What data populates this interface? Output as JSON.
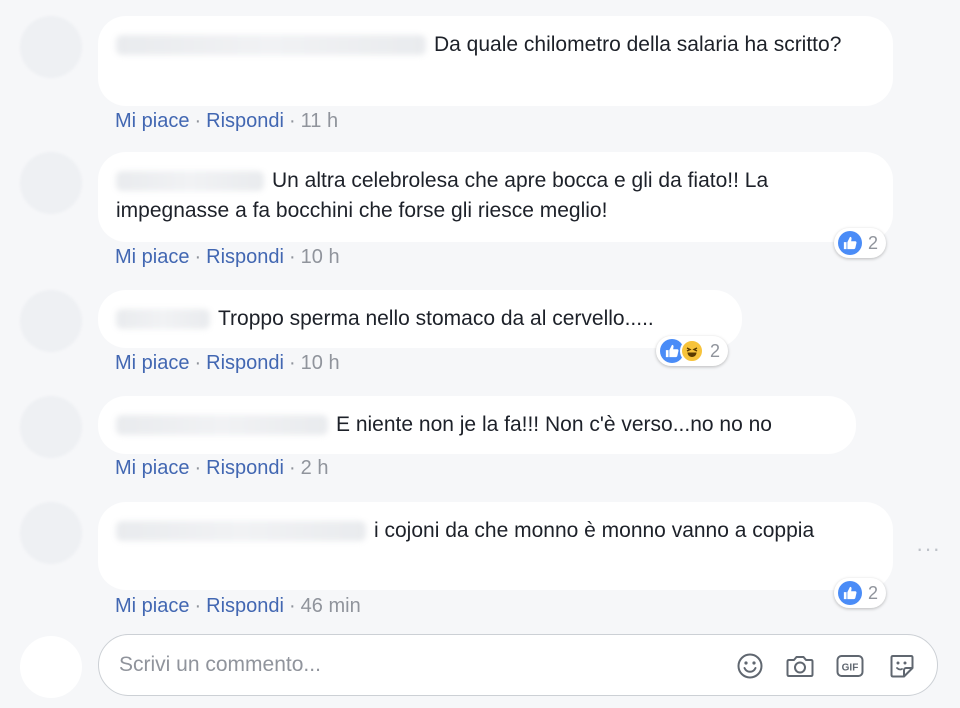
{
  "comments": [
    {
      "text": "Da quale chilometro della salaria ha scritto?",
      "like": "Mi piace",
      "reply": "Rispondi",
      "time": "11 h",
      "reaction_count": null
    },
    {
      "text": "Un altra celebrolesa che apre bocca e gli da fiato!! La impegnasse a fa bocchini che forse gli riesce meglio!",
      "like": "Mi piace",
      "reply": "Rispondi",
      "time": "10 h",
      "reaction_count": "2"
    },
    {
      "text": "Troppo sperma nello stomaco da al cervello.....",
      "like": "Mi piace",
      "reply": "Rispondi",
      "time": "10 h",
      "reaction_count": "2"
    },
    {
      "text": "E niente non je la fa!!! Non c'è verso...no no no",
      "like": "Mi piace",
      "reply": "Rispondi",
      "time": "2 h",
      "reaction_count": null
    },
    {
      "text": "i cojoni da che monno è monno vanno a coppia",
      "like": "Mi piace",
      "reply": "Rispondi",
      "time": "46 min",
      "reaction_count": "2"
    }
  ],
  "separator": "·",
  "more_options": "···",
  "composer": {
    "placeholder": "Scrivi un commento...",
    "gif_label": "GIF",
    "icons": [
      "emoji-icon",
      "camera-icon",
      "gif-icon",
      "sticker-icon"
    ]
  },
  "colors": {
    "link": "#4267b2",
    "meta": "#90949c",
    "like": "#4a8cf7",
    "haha": "#f7c33b",
    "background": "#f6f7f9"
  }
}
